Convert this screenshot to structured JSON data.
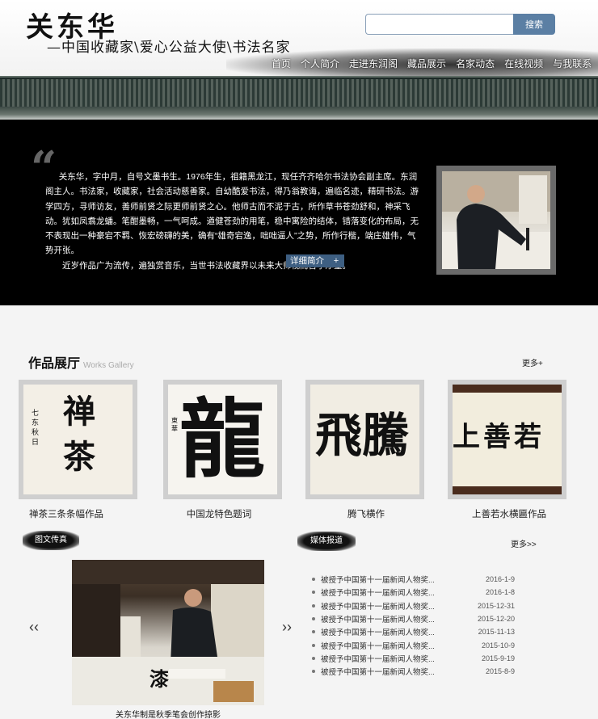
{
  "header": {
    "logo_name": "关东华",
    "logo_subtitle": "—中国收藏家\\爱心公益大使\\书法名家",
    "search_placeholder": "",
    "search_button": "搜索"
  },
  "nav": [
    "首页",
    "个人简介",
    "走进东润阁",
    "藏品展示",
    "名家动态",
    "在线视频",
    "与我联系"
  ],
  "intro": {
    "paragraphs": [
      "关东华，字中月，自号文墨书生。1976年生，祖籍黑龙江，现任齐齐哈尔书法协会副主席。东润阁主人。书法家，收藏家，社会活动慈善家。自幼酷爱书法，得乃翁教诲，遍临名迹，精研书法。游学四方，寻师访友，善师前贤之际更师前贤之心。他师古而不泥于古，所作草书苍劲舒和，神采飞动。犹如凤翥龙蟠。笔酣墨畅，一气呵成。遒健苍劲的用笔，稳中寓险的结体，错落变化的布局，无不表现出一种豪宕不羁、恢宏磅礴的美，确有“雄奇宕逸，咄咄逼人”之势，所作行楷，端庄雄伟，气势开张。",
      "近岁作品广为流传，遍独赏音乐，当世书法收藏界以未来大师视而善予厚望。"
    ],
    "detail_button": "详细简介",
    "plus_button": "+"
  },
  "gallery": {
    "title": "作品展厅",
    "title_en": "Works Gallery",
    "more": "更多+",
    "items": [
      {
        "caption": "禅茶三条条幅作品",
        "chars": "禅茶",
        "side": "七东秋日"
      },
      {
        "caption": "中国龙特色题词",
        "chars": "龍",
        "side": "東華"
      },
      {
        "caption": "腾飞横作",
        "chars": "飛騰",
        "side": ""
      },
      {
        "caption": "上善若水横匾作品",
        "chars": "上善若",
        "side": ""
      }
    ]
  },
  "photo_news": {
    "badge": "图文传真",
    "prev": "‹‹",
    "next": "››",
    "caption": "关东华制是秋季笔会创作掠影"
  },
  "media": {
    "badge": "媒体报道",
    "more": "更多>>",
    "items": [
      {
        "title": "被授予中国第十一届新闻人物奖...",
        "date": "2016-1-9"
      },
      {
        "title": "被授予中国第十一届新闻人物奖...",
        "date": "2016-1-8"
      },
      {
        "title": "被授予中国第十一届新闻人物奖...",
        "date": "2015-12-31"
      },
      {
        "title": "被授予中国第十一届新闻人物奖...",
        "date": "2015-12-20"
      },
      {
        "title": "被授予中国第十一届新闻人物奖...",
        "date": "2015-11-13"
      },
      {
        "title": "被授予中国第十一届新闻人物奖...",
        "date": "2015-10-9"
      },
      {
        "title": "被授予中国第十一届新闻人物奖...",
        "date": "2015-9-19"
      },
      {
        "title": "被授予中国第十一届新闻人物奖...",
        "date": "2015-8-9"
      }
    ]
  }
}
